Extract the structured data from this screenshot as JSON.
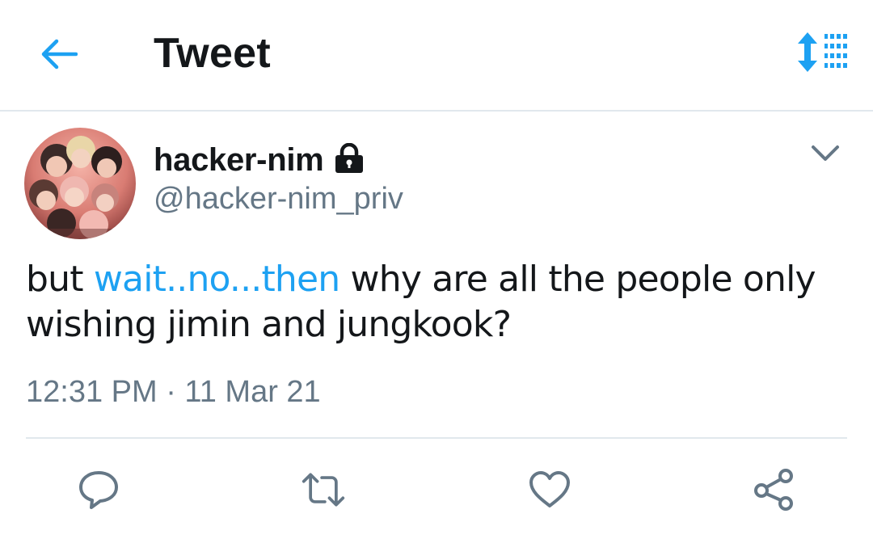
{
  "header": {
    "title": "Tweet",
    "back_icon": "arrow-left-icon",
    "sort_icon": "sort-updown-list-icon",
    "accent_color": "#1da1f2"
  },
  "tweet": {
    "author": {
      "display_name": "hacker-nim",
      "handle": "@hacker-nim_priv",
      "protected_icon": "lock-icon"
    },
    "text": {
      "before": "but ",
      "link": "wait..no...then",
      "after": " why are all the people only wishing jimin and jungkook?"
    },
    "timestamp": "12:31 PM · 11 Mar 21"
  },
  "actions": [
    {
      "name": "reply",
      "icon": "reply-icon"
    },
    {
      "name": "retweet",
      "icon": "retweet-icon"
    },
    {
      "name": "like",
      "icon": "heart-icon"
    },
    {
      "name": "share",
      "icon": "share-icon"
    }
  ],
  "colors": {
    "text": "#14171a",
    "secondary": "#657786",
    "border": "#e1e8ed"
  }
}
